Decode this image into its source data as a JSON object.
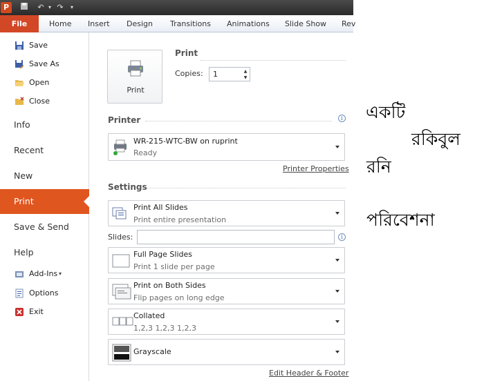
{
  "titlebar": {
    "app_icon": "P"
  },
  "ribbon": {
    "tabs": [
      "File",
      "Home",
      "Insert",
      "Design",
      "Transitions",
      "Animations",
      "Slide Show",
      "Rev"
    ]
  },
  "nav": {
    "save": "Save",
    "save_as": "Save As",
    "open": "Open",
    "close": "Close",
    "info": "Info",
    "recent": "Recent",
    "new": "New",
    "print": "Print",
    "save_send": "Save & Send",
    "help": "Help",
    "add_ins": "Add-Ins",
    "options": "Options",
    "exit": "Exit"
  },
  "print_panel": {
    "button_label": "Print",
    "heading": "Print",
    "copies_label": "Copies:",
    "copies_value": "1"
  },
  "printer": {
    "heading": "Printer",
    "name": "WR-215-WTC-BW on ruprint",
    "status": "Ready",
    "properties_link": "Printer Properties"
  },
  "settings": {
    "heading": "Settings",
    "range_title": "Print All Slides",
    "range_sub": "Print entire presentation",
    "slides_label": "Slides:",
    "slides_value": "",
    "layout_title": "Full Page Slides",
    "layout_sub": "Print 1 slide per page",
    "sides_title": "Print on Both Sides",
    "sides_sub": "Flip pages on long edge",
    "collate_title": "Collated",
    "collate_sub": "1,2,3    1,2,3    1,2,3",
    "color_title": "Grayscale",
    "header_footer_link": "Edit Header & Footer"
  },
  "bengali": {
    "line1": "একটি",
    "line2": "রকিবুল",
    "line3": "রনি",
    "line4": "পরিবেশনা"
  },
  "colors": {
    "accent": "#e0561f",
    "file_tab": "#d24726"
  }
}
